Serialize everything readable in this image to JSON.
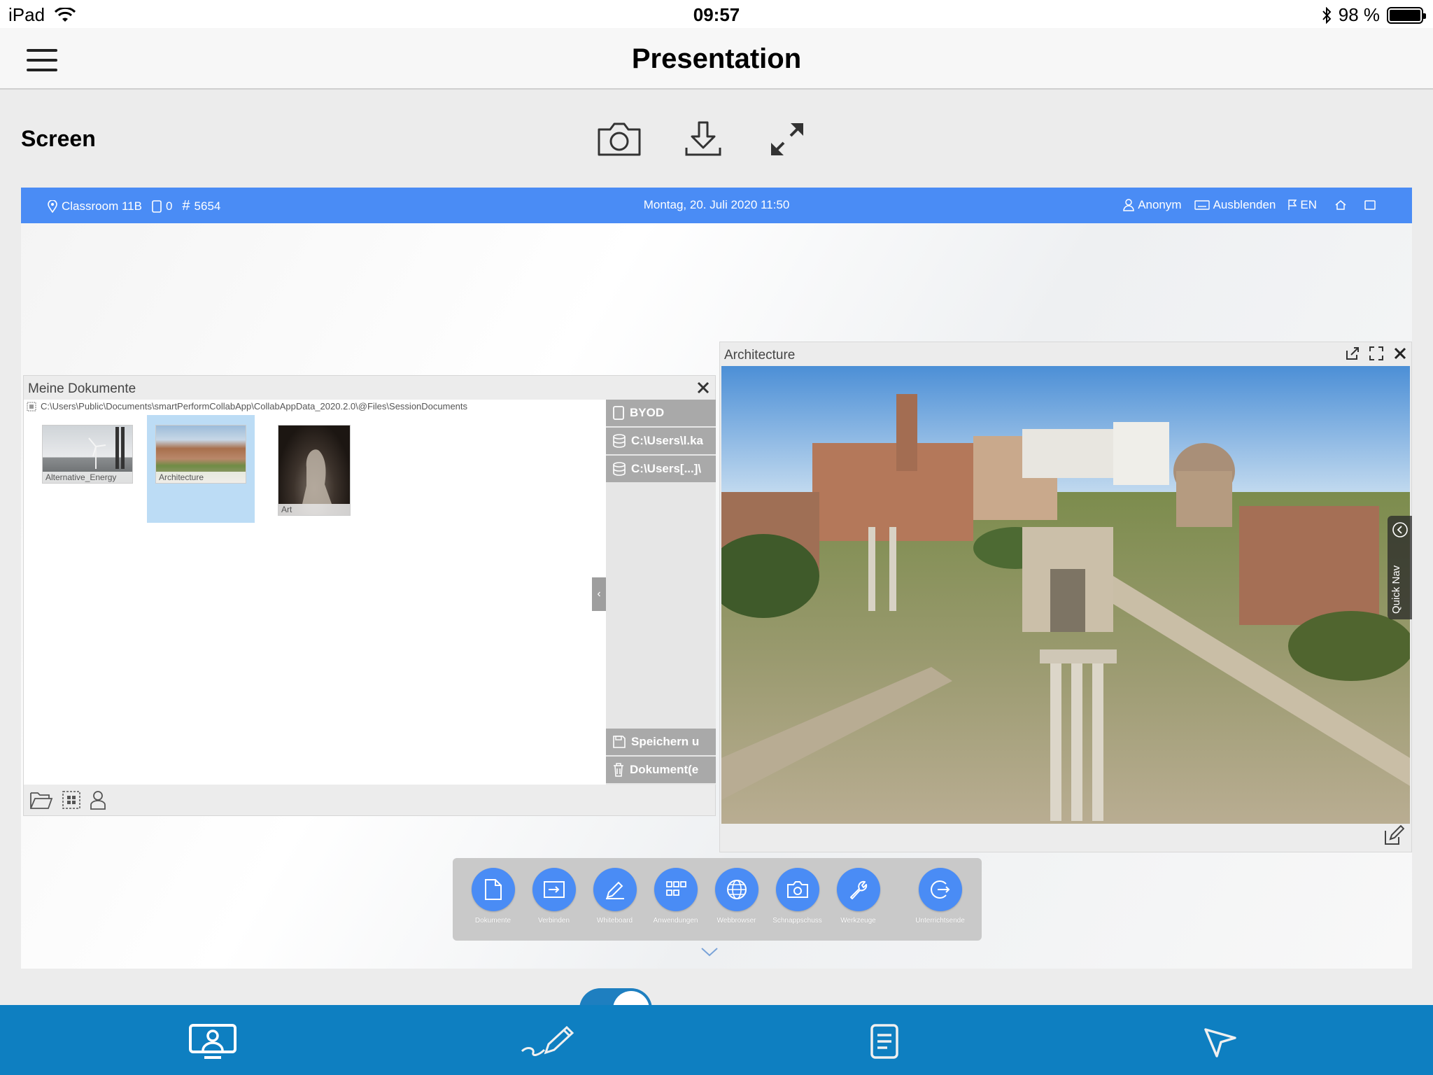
{
  "status_bar": {
    "device": "iPad",
    "time": "09:57",
    "battery": "98 %"
  },
  "nav": {
    "title": "Presentation"
  },
  "screen": {
    "label": "Screen",
    "icons": [
      "camera-icon",
      "download-icon",
      "expand-icon"
    ]
  },
  "mirror": {
    "bar": {
      "room": "Classroom 11B",
      "device_count": "0",
      "session_code": "5654",
      "datetime": "Montag, 20. Juli 2020   11:50",
      "user": "Anonym",
      "hide": "Ausblenden",
      "language": "EN"
    },
    "docs_window": {
      "title": "Meine Dokumente",
      "path": "C:\\Users\\Public\\Documents\\smartPerformCollabApp\\CollabAppData_2020.2.0\\@Files\\SessionDocuments",
      "thumbnails": [
        {
          "label": "Alternative_Energy",
          "selected": false
        },
        {
          "label": "Architecture",
          "selected": true
        },
        {
          "label": "Art",
          "selected": false
        }
      ],
      "sidebar": [
        "BYOD",
        "C:\\Users\\l.ka",
        "C:\\Users[...]\\"
      ],
      "sidebar_bottom": [
        "Speichern u",
        "Dokument(e"
      ]
    },
    "arch_window": {
      "title": "Architecture",
      "quick_nav": "Quick Nav"
    },
    "toolbar": [
      {
        "label": "Dokumente",
        "icon": "document-icon"
      },
      {
        "label": "Verbinden",
        "icon": "connect-icon"
      },
      {
        "label": "Whiteboard",
        "icon": "pencil-icon"
      },
      {
        "label": "Anwendungen",
        "icon": "apps-grid-icon"
      },
      {
        "label": "Webbrowser",
        "icon": "globe-icon"
      },
      {
        "label": "Schnappschuss",
        "icon": "camera-icon"
      },
      {
        "label": "Werkzeuge",
        "icon": "wrench-icon"
      },
      {
        "label": "Unterrichtsende",
        "icon": "exit-icon"
      }
    ]
  },
  "tabbar": {
    "tabs": [
      "presentation-tab",
      "whiteboard-tab",
      "notes-tab",
      "share-tab"
    ],
    "active": "presentation-tab"
  },
  "colors": {
    "accent_blue": "#4a8cf5",
    "tabbar_blue": "#0e7fc1",
    "selection": "#bcdcf5"
  }
}
